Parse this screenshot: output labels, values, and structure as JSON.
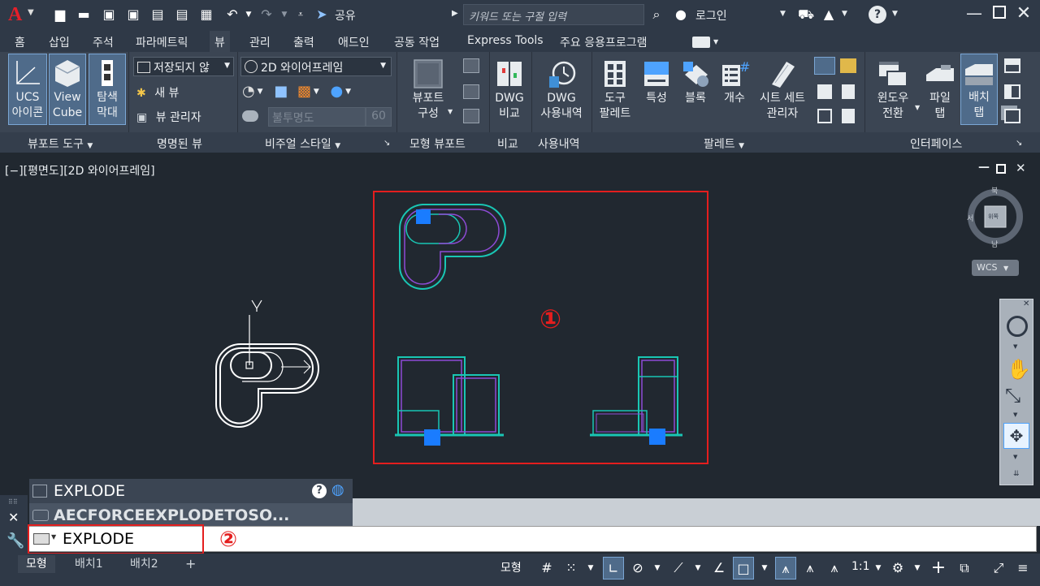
{
  "title_bar": {
    "share_label": "공유",
    "search_placeholder": "키워드 또는 구절 입력",
    "login_label": "로그인"
  },
  "menu_tabs": [
    "홈",
    "삽입",
    "주석",
    "파라메트릭",
    "뷰",
    "관리",
    "출력",
    "애드인",
    "공동 작업",
    "Express Tools",
    "주요 응용프로그램"
  ],
  "active_tab": "뷰",
  "ribbon": {
    "ucs_icon": "UCS\n아이콘",
    "ucs_icon_l1": "UCS",
    "ucs_icon_l2": "아이콘",
    "viewcube_l1": "View",
    "viewcube_l2": "Cube",
    "navbar_l1": "탐색",
    "navbar_l2": "막대",
    "unsaved_view": "저장되지 않",
    "new_view": "새 뷰",
    "view_manager": "뷰 관리자",
    "visual_style": "2D 와이어프레임",
    "opacity_label": "불투명도",
    "opacity_value": "60",
    "viewport_config_l1": "뷰포트",
    "viewport_config_l2": "구성",
    "dwg_compare_l1": "DWG",
    "dwg_compare_l2": "비교",
    "dwg_history_l1": "DWG",
    "dwg_history_l2": "사용내역",
    "tool_palette_l1": "도구",
    "tool_palette_l2": "팔레트",
    "properties": "특성",
    "block": "블록",
    "count": "개수",
    "sheet_set_l1": "시트 세트",
    "sheet_set_l2": "관리자",
    "switch_window_l1": "윈도우",
    "switch_window_l2": "전환",
    "file_tab_l1": "파일",
    "file_tab_l2": "탭",
    "layout_tab_l1": "배치",
    "layout_tab_l2": "탭"
  },
  "panel_labels": {
    "viewport_tools": "뷰포트 도구",
    "named_views": "명명된 뷰",
    "visual_styles": "비주얼 스타일",
    "model_viewports": "모형 뷰포트",
    "compare": "비교",
    "history": "사용내역",
    "palettes": "팔레트",
    "interface": "인터페이스"
  },
  "viewport_label": "[−][평면도][2D 와이어프레임]",
  "viewcube": {
    "north": "북",
    "south": "남",
    "west": "서",
    "top": "위쪽",
    "wcs": "WCS"
  },
  "ucs_y_label": "Y",
  "annotations": {
    "marker1": "①",
    "marker2": "②"
  },
  "command": {
    "history_1": "EXPLODE",
    "history_2": "AECFORCEEXPLODETOSO...",
    "input_value": "EXPLODE"
  },
  "layout_tabs": [
    "모형",
    "배치1",
    "배치2"
  ],
  "active_layout": "모형",
  "status": {
    "model_label": "모형",
    "scale": "1:1"
  },
  "colors": {
    "annotation_red": "#e41e1e",
    "grip_blue": "#1a7cff",
    "highlight_cyan": "#19c6b4",
    "highlight_purple": "#8e4bd6"
  }
}
